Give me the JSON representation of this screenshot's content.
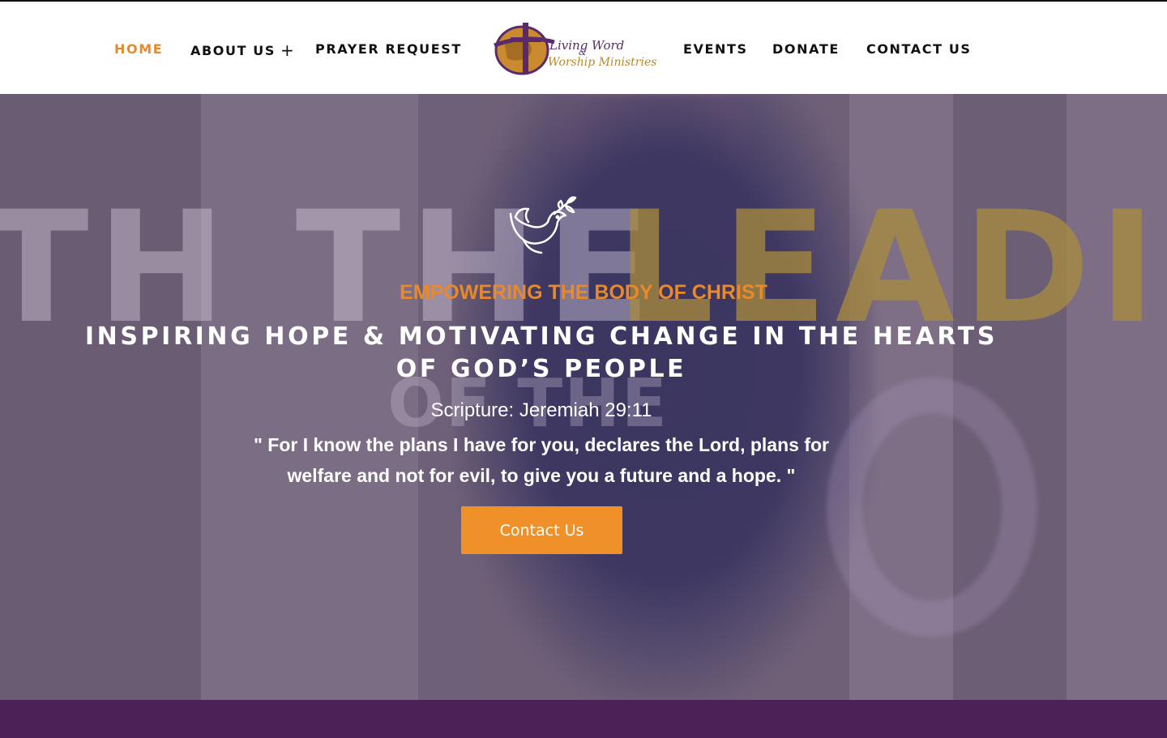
{
  "nav": {
    "home": "HOME",
    "about": "ABOUT US",
    "about_expand": "+",
    "prayer": "PRAYER REQUEST",
    "events": "EVENTS",
    "donate": "DONATE",
    "contact": "CONTACT US"
  },
  "logo": {
    "line1": "Living Word",
    "amp": "&",
    "line2": "Worship Ministries"
  },
  "hero": {
    "background_words": {
      "left": "TH THE",
      "right": "LEADIN",
      "middle": "OF THE"
    },
    "icon": "dove-icon",
    "tagline": "EMPOWERING THE BODY OF CHRIST",
    "headline": "INSPIRING HOPE & MOTIVATING CHANGE IN THE HEARTS OF GOD’S PEOPLE",
    "scripture_ref": "Scripture: Jeremiah 29:11",
    "quote": "\" For I know the plans I have for you, declares the Lord, plans for welfare and not for evil, to give you a future and a hope. \"",
    "cta_label": "Contact Us"
  },
  "colors": {
    "accent": "#ef9128",
    "nav_active": "#e8892b",
    "footer_band": "#4b2158",
    "hero_overlay": "#6f6078"
  }
}
